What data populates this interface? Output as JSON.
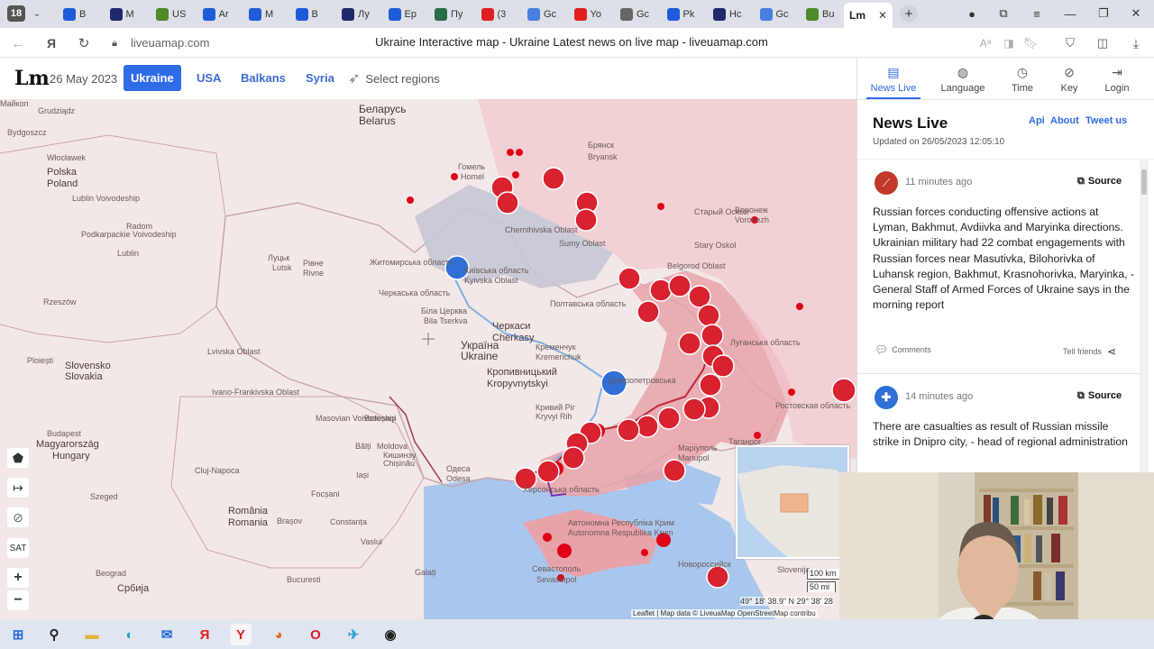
{
  "browser": {
    "tab_count": "18",
    "tabs": [
      {
        "label": "В",
        "color": "#1e5bd8"
      },
      {
        "label": "М",
        "color": "#1f2a6b"
      },
      {
        "label": "US",
        "color": "#4d8a2a"
      },
      {
        "label": "Ar",
        "color": "#1e5bd8"
      },
      {
        "label": "М",
        "color": "#1e5bd8"
      },
      {
        "label": "В",
        "color": "#1e5bd8"
      },
      {
        "label": "Лу",
        "color": "#1f2a6b"
      },
      {
        "label": "Ер",
        "color": "#1e5bd8"
      },
      {
        "label": "Пу",
        "color": "#2a6b4a"
      },
      {
        "label": "(3",
        "color": "#e02020"
      },
      {
        "label": "Gc",
        "color": "#4a7fe0"
      },
      {
        "label": "Yo",
        "color": "#e02020"
      },
      {
        "label": "Gc",
        "color": "#666666"
      },
      {
        "label": "Pk",
        "color": "#1e5bd8"
      },
      {
        "label": "Hc",
        "color": "#1f2a6b"
      },
      {
        "label": "Gc",
        "color": "#4a7fe0"
      },
      {
        "label": "Bu",
        "color": "#4d8a2a"
      }
    ],
    "active_tab_icon": "Lm",
    "url": "liveuamap.com",
    "page_title": "Ukraine Interactive map - Ukraine Latest news on live map - liveuamap.com"
  },
  "site": {
    "logo": "Lm",
    "date": "26 May 2023",
    "regions": [
      "Ukraine",
      "USA",
      "Balkans",
      "Syria"
    ],
    "active_region": "Ukraine",
    "select_regions": "Select regions"
  },
  "panel": {
    "tabs": [
      {
        "label": "News Live",
        "icon": "news-icon"
      },
      {
        "label": "Language",
        "icon": "globe-icon"
      },
      {
        "label": "Time",
        "icon": "clock-icon"
      },
      {
        "label": "Key",
        "icon": "compass-icon"
      },
      {
        "label": "Login",
        "icon": "login-icon"
      }
    ],
    "title": "News Live",
    "links": [
      "Api",
      "About",
      "Tweet us"
    ],
    "updated": "Updated on 26/05/2023 12:05:10",
    "news": [
      {
        "time": "11 minutes ago",
        "source": "Source",
        "icon_color": "#c0392b",
        "text": "Russian forces conducting offensive actions at Lyman, Bakhmut, Avdiivka and Maryinka directions. Ukrainian military had 22 combat engagements with Russian forces near Masutivka, Bilohorivka of Luhansk region, Bakhmut, Krasnohorivka, Maryinka, - General Staff of Armed Forces of Ukraine says in the morning report",
        "comments": "Comments",
        "tell": "Tell friends"
      },
      {
        "time": "14 minutes ago",
        "source": "Source",
        "icon_color": "#2f6fd6",
        "text": "There are casualties as result of Russian missile strike in Dnipro city, - head of regional administration"
      }
    ]
  },
  "map": {
    "labels": [
      {
        "t": "Bydgoszcz",
        "c": ""
      },
      {
        "t": "Grudziądz",
        "c": ""
      },
      {
        "t": "Włocławek",
        "c": ""
      },
      {
        "t": "Polska",
        "c": "big"
      },
      {
        "t": "Poland",
        "c": "big"
      },
      {
        "t": "Radom",
        "c": ""
      },
      {
        "t": "Lublin",
        "c": ""
      },
      {
        "t": "Rzeszów",
        "c": ""
      },
      {
        "t": "Slovensko",
        "c": "big"
      },
      {
        "t": "Slovakia",
        "c": "big"
      },
      {
        "t": "Budapest",
        "c": ""
      },
      {
        "t": "Magyarország",
        "c": "big"
      },
      {
        "t": "Hungary",
        "c": "big"
      },
      {
        "t": "Szeged",
        "c": ""
      },
      {
        "t": "Cluj-Napoca",
        "c": ""
      },
      {
        "t": "România",
        "c": "big"
      },
      {
        "t": "Romania",
        "c": "big"
      },
      {
        "t": "Brașov",
        "c": ""
      },
      {
        "t": "Beograd",
        "c": ""
      },
      {
        "t": "Србија",
        "c": "big"
      },
      {
        "t": "Bucuresti",
        "c": ""
      },
      {
        "t": "Беларусь",
        "c": "country"
      },
      {
        "t": "Belarus",
        "c": "country"
      },
      {
        "t": "Гомель",
        "c": ""
      },
      {
        "t": "Homel",
        "c": ""
      },
      {
        "t": "Брянск",
        "c": ""
      },
      {
        "t": "Bryansk",
        "c": ""
      },
      {
        "t": "Воронеж",
        "c": ""
      },
      {
        "t": "Voronezh",
        "c": ""
      },
      {
        "t": "Луцьк",
        "c": ""
      },
      {
        "t": "Lutsk",
        "c": ""
      },
      {
        "t": "Рівне",
        "c": ""
      },
      {
        "t": "Rivne",
        "c": ""
      },
      {
        "t": "Біла Церква",
        "c": ""
      },
      {
        "t": "Bila Tserkva",
        "c": ""
      },
      {
        "t": "Черкаси",
        "c": "big"
      },
      {
        "t": "Cherkasy",
        "c": "big"
      },
      {
        "t": "Україна",
        "c": "country"
      },
      {
        "t": "Ukraine",
        "c": "country"
      },
      {
        "t": "Кропивницький",
        "c": "big"
      },
      {
        "t": "Kropyvnytskyi",
        "c": "big"
      },
      {
        "t": "Кривий Ріг",
        "c": ""
      },
      {
        "t": "Kryvyi Rih",
        "c": ""
      },
      {
        "t": "Кременчук",
        "c": ""
      },
      {
        "t": "Kremenchuk",
        "c": ""
      },
      {
        "t": "Маріуполь",
        "c": ""
      },
      {
        "t": "Mariupol",
        "c": ""
      },
      {
        "t": "Таганрог",
        "c": ""
      },
      {
        "t": "Кишинэу",
        "c": ""
      },
      {
        "t": "Chișinău",
        "c": ""
      },
      {
        "t": "Moldova",
        "c": ""
      },
      {
        "t": "Одеса",
        "c": ""
      },
      {
        "t": "Odesa",
        "c": ""
      },
      {
        "t": "Севастополь",
        "c": ""
      },
      {
        "t": "Sevastopol",
        "c": ""
      },
      {
        "t": "Новороссийск",
        "c": ""
      },
      {
        "t": "Старый Оскол",
        "c": ""
      },
      {
        "t": "Stary Oskol",
        "c": ""
      },
      {
        "t": "Черкаська область",
        "c": ""
      },
      {
        "t": "Житомирська область",
        "c": ""
      },
      {
        "t": "Київська область",
        "c": ""
      },
      {
        "t": "Kyivska Oblast",
        "c": ""
      },
      {
        "t": "Полтавська область",
        "c": ""
      },
      {
        "t": "Дніпропетровська",
        "c": ""
      },
      {
        "t": "Луганська область",
        "c": ""
      },
      {
        "t": "Ростовская область",
        "c": ""
      },
      {
        "t": "Автономна Республіка Крим",
        "c": ""
      },
      {
        "t": "Autonomna Respublika Krym",
        "c": ""
      },
      {
        "t": "Херсонська область",
        "c": ""
      },
      {
        "t": "Chernihivska Oblast",
        "c": ""
      },
      {
        "t": "Sumy Oblast",
        "c": ""
      },
      {
        "t": "Belgorod Oblast",
        "c": ""
      },
      {
        "t": "Ivano-Frankivska Oblast",
        "c": ""
      },
      {
        "t": "Lvivska Oblast",
        "c": ""
      },
      {
        "t": "Podkarpackie Voivodeship",
        "c": ""
      },
      {
        "t": "Lublin Voivodeship",
        "c": ""
      },
      {
        "t": "Masovian Voivodeship",
        "c": ""
      },
      {
        "t": "Botoșani",
        "c": ""
      },
      {
        "t": "Bălți",
        "c": ""
      },
      {
        "t": "Iași",
        "c": ""
      },
      {
        "t": "Vaslui",
        "c": ""
      },
      {
        "t": "Galați",
        "c": ""
      },
      {
        "t": "Constanța",
        "c": ""
      },
      {
        "t": "Focșani",
        "c": ""
      },
      {
        "t": "Ploiești",
        "c": ""
      },
      {
        "t": "Slovenija",
        "c": ""
      },
      {
        "t": "Майкоп",
        "c": ""
      }
    ],
    "scale_km": "100 km",
    "scale_mi": "50 mi",
    "coords": "49° 18' 38.9\" N 29° 38' 28",
    "attribution": "Leaflet | Map data © LiveuaMap OpenStreetMap contribu",
    "sat": "SAT"
  },
  "taskbar": {
    "items": [
      {
        "name": "start",
        "icon": "windows-icon"
      },
      {
        "name": "search",
        "icon": "search-icon"
      },
      {
        "name": "explorer",
        "icon": "folder-icon"
      },
      {
        "name": "edge",
        "icon": "edge-icon"
      },
      {
        "name": "mail",
        "icon": "mail-icon"
      },
      {
        "name": "yandex",
        "icon": "Я"
      },
      {
        "name": "yandex-browser",
        "icon": "Y"
      },
      {
        "name": "firefox",
        "icon": "firefox-icon"
      },
      {
        "name": "opera",
        "icon": "O"
      },
      {
        "name": "telegram",
        "icon": "telegram-icon"
      },
      {
        "name": "obs",
        "icon": "obs-icon"
      }
    ]
  }
}
